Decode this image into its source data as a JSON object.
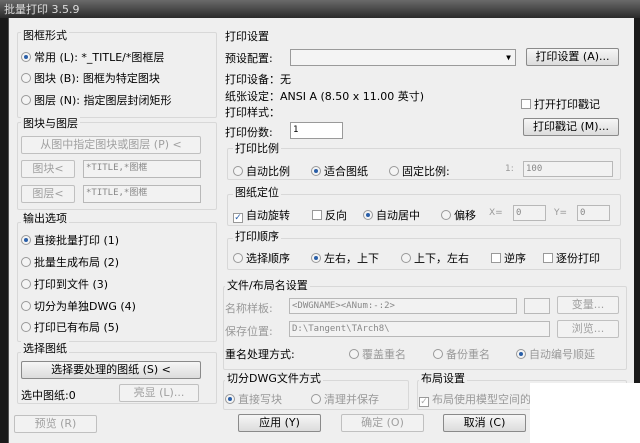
{
  "window": {
    "title": "批量打印 3.5.9"
  },
  "frame_type": {
    "title": "图框形式",
    "options": [
      {
        "label": "常用 (L): *_TITLE/*图框层",
        "selected": true
      },
      {
        "label": "图块 (B): 图框为特定图块",
        "selected": false
      },
      {
        "label": "图层 (N): 指定图层封闭矩形",
        "selected": false
      }
    ]
  },
  "block_layer": {
    "title": "图块与图层",
    "pick_button": "从图中指定图块或图层 (P) <",
    "block_button": "图块<",
    "block_value": "*TITLE,*图框",
    "layer_button": "图层<",
    "layer_value": "*TITLE,*图框"
  },
  "output": {
    "title": "输出选项",
    "options": [
      {
        "label": "直接批量打印 (1)",
        "selected": true
      },
      {
        "label": "批量生成布局 (2)",
        "selected": false
      },
      {
        "label": "打印到文件 (3)",
        "selected": false
      },
      {
        "label": "切分为单独DWG (4)",
        "selected": false
      },
      {
        "label": "打印已有布局 (5)",
        "selected": false
      }
    ]
  },
  "select": {
    "title": "选择图纸",
    "select_button": "选择要处理的图纸 (S) <",
    "selected_label": "选中图纸:0",
    "highlight_button": "亮显 (L)..."
  },
  "preview_button": "预览 (R)",
  "print": {
    "title": "打印设置",
    "preset_label": "预设配置:",
    "preset_value": "",
    "setup_button": "打印设置 (A)...",
    "device": "打印设备：无",
    "paper": "纸张设定：ANSI A (8.50 x 11.00 英寸)",
    "style": "打印样式：",
    "copies_label": "打印份数:",
    "copies_value": "1",
    "stamp_check": "打开打印戳记",
    "stamp_button": "打印戳记 (M)..."
  },
  "scale": {
    "title": "打印比例",
    "options": [
      "自动比例",
      "适合图纸",
      "固定比例:"
    ],
    "selected": 1,
    "ratio_label": "1:",
    "ratio_value": "100"
  },
  "position": {
    "title": "图纸定位",
    "auto_rotate": "自动旋转",
    "reverse": "反向",
    "center": "自动居中",
    "offset": "偏移",
    "x_label": "X=",
    "x_value": "0",
    "y_label": "Y=",
    "y_value": "0"
  },
  "order": {
    "title": "打印顺序",
    "options": [
      "选择顺序",
      "左右，上下",
      "上下，左右"
    ],
    "selected": 1,
    "reverse": "逆序",
    "collate": "逐份打印"
  },
  "file": {
    "title": "文件/布局名设置",
    "template_label": "名称样板:",
    "template_value": "<DWGNAME><ANum:-:2>",
    "var_button": "变量...",
    "save_label": "保存位置:",
    "save_value": "D:\\Tangent\\TArch8\\",
    "browse_button": "浏览...",
    "rename_label": "重名处理方式:",
    "rename_options": [
      "覆盖重名",
      "备份重名",
      "自动编号顺延"
    ]
  },
  "split": {
    "title": "切分DWG文件方式",
    "options": [
      "直接写块",
      "清理并保存"
    ]
  },
  "layout": {
    "title": "布局设置",
    "check": "布局使用模型空间的"
  },
  "buttons": {
    "apply": "应用 (Y)",
    "ok": "确定 (O)",
    "cancel": "取消 (C)"
  }
}
